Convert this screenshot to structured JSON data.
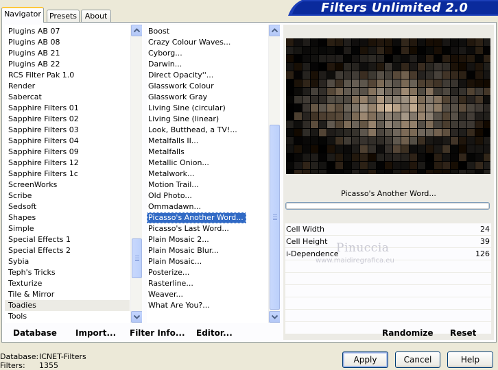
{
  "window": {
    "title": "Filters Unlimited 2.0"
  },
  "tabs": [
    {
      "label": "Navigator",
      "active": true
    },
    {
      "label": "Presets",
      "active": false
    },
    {
      "label": "About",
      "active": false
    }
  ],
  "categories": {
    "items": [
      "Plugins AB 07",
      "Plugins AB 08",
      "Plugins AB 21",
      "Plugins AB 22",
      "RCS Filter Pak 1.0",
      "Render",
      "Sabercat",
      "Sapphire Filters 01",
      "Sapphire Filters 02",
      "Sapphire Filters 03",
      "Sapphire Filters 04",
      "Sapphire Filters 09",
      "Sapphire Filters 12",
      "Sapphire Filters 1c",
      "ScreenWorks",
      "Scribe",
      "Sedsoft",
      "Shapes",
      "Simple",
      "Special Effects 1",
      "Special Effects 2",
      "Sybia",
      "Teph's Tricks",
      "Texturize",
      "Tile & Mirror",
      "Toadies",
      "Tools"
    ],
    "selected": "Toadies"
  },
  "filters": {
    "items": [
      "Boost",
      "Crazy Colour Waves...",
      "Cyborg...",
      "Darwin...",
      "Direct Opacity''...",
      "Glasswork Colour",
      "Glasswork Gray",
      "Living Sine (circular)",
      "Living Sine (linear)",
      "Look, Butthead, a TV!...",
      "Metalfalls II...",
      "Metalfalls",
      "Metallic Onion...",
      "Metalwork...",
      "Motion Trail...",
      "Old Photo...",
      "Ommadawn...",
      "Picasso's Another Word...",
      "Picasso's Last Word...",
      "Plain Mosaic 2...",
      "Plain Mosaic Blur...",
      "Plain Mosaic...",
      "Posterize...",
      "Rasterline...",
      "Weaver...",
      "What Are You?..."
    ],
    "selected": "Picasso's Another Word..."
  },
  "preview": {
    "filter_name": "Picasso's Another Word...",
    "progress": 0
  },
  "params": [
    {
      "label": "Cell Width",
      "value": "24"
    },
    {
      "label": "Cell Height",
      "value": "39"
    },
    {
      "label": "i-Dependence",
      "value": "126"
    }
  ],
  "watermark": {
    "title": "Pinuccia",
    "url": "www.maidiregrafica.eu"
  },
  "commands": {
    "database": "Database",
    "import": "Import...",
    "filter_info": "Filter Info...",
    "editor": "Editor...",
    "randomize": "Randomize",
    "reset": "Reset"
  },
  "status": {
    "database_label": "Database:",
    "database_value": "ICNET-Filters",
    "filters_label": "Filters:",
    "filters_value": "1355"
  },
  "buttons": {
    "apply": "Apply",
    "cancel": "Cancel",
    "help": "Help"
  },
  "colors": {
    "selection": "#316ac5",
    "banner": "#0a2a9c"
  }
}
